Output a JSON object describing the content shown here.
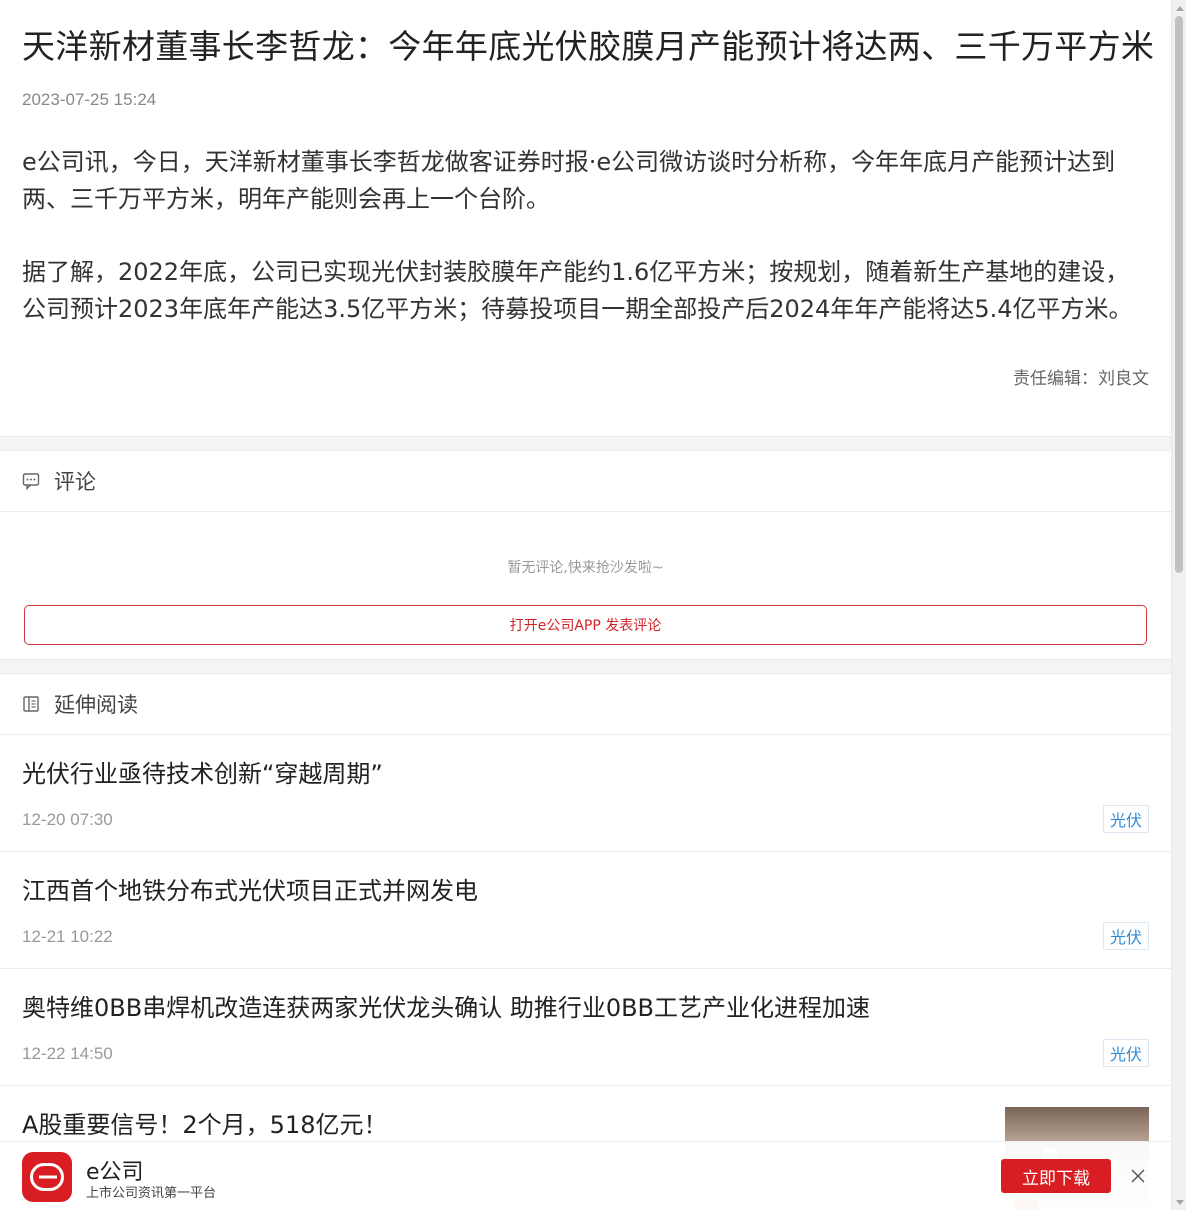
{
  "article": {
    "title": "天洋新材董事长李哲龙：今年年底光伏胶膜月产能预计将达两、三千万平方米",
    "time": "2023-07-25 15:24",
    "paragraphs": [
      "e公司讯，今日，天洋新材董事长李哲龙做客证券时报·e公司微访谈时分析称，今年年底月产能预计达到两、三千万平方米，明年产能则会再上一个台阶。",
      "据了解，2022年底，公司已实现光伏封装胶膜年产能约1.6亿平方米；按规划，随着新生产基地的建设，公司预计2023年底年产能达3.5亿平方米；待募投项目一期全部投产后2024年年产能将达5.4亿平方米。"
    ],
    "editor": "责任编辑：刘良文"
  },
  "comments": {
    "header": "评论",
    "empty_text": "暂无评论,快来抢沙发啦~",
    "open_app_label": "打开e公司APP 发表评论"
  },
  "related": {
    "header": "延伸阅读",
    "items": [
      {
        "title": "光伏行业亟待技术创新“穿越周期”",
        "time": "12-20 07:30",
        "tag": "光伏"
      },
      {
        "title": "江西首个地铁分布式光伏项目正式并网发电",
        "time": "12-21 10:22",
        "tag": "光伏"
      },
      {
        "title": "奥特维0BB串焊机改造连获两家光伏龙头确认 助推行业0BB工艺产业化进程加速",
        "time": "12-22 14:50",
        "tag": "光伏"
      },
      {
        "title": "A股重要信号！2个月，518亿元！",
        "time": "",
        "tag": ""
      }
    ]
  },
  "app_banner": {
    "name": "e公司",
    "slogan": "上市公司资讯第一平台",
    "download_label": "立即下载",
    "brand_color": "#d81e22"
  },
  "icons": {
    "comment": "comment-bubble-icon",
    "reading": "book-icon",
    "close": "close-icon",
    "logo": "e-company-logo"
  }
}
